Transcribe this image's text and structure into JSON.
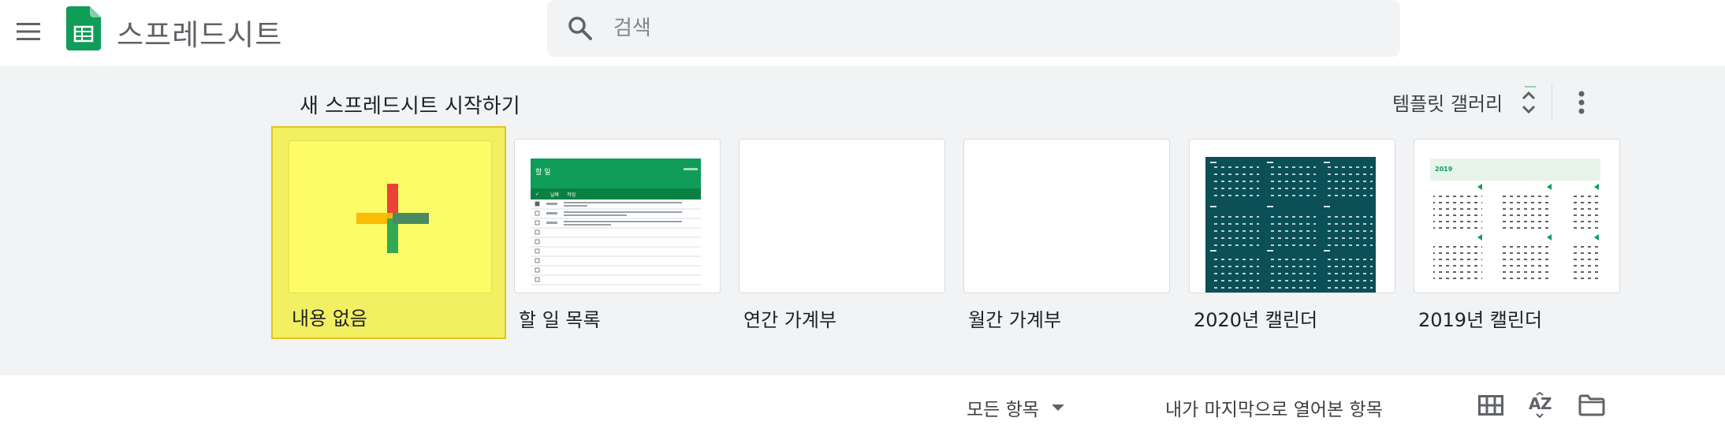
{
  "header": {
    "menu_icon": "hamburger-menu-icon",
    "logo_icon": "google-sheets-logo",
    "app_title": "스프레드시트",
    "search": {
      "placeholder": "검색",
      "value": ""
    }
  },
  "templates": {
    "section_title": "새 스프레드시트 시작하기",
    "gallery_label": "템플릿 갤러리",
    "items": [
      {
        "label": "내용 없음",
        "kind": "blank",
        "highlighted": true
      },
      {
        "label": "할 일 목록",
        "kind": "todo"
      },
      {
        "label": "연간 가계부",
        "kind": "annual-budget"
      },
      {
        "label": "월간 가계부",
        "kind": "monthly-budget"
      },
      {
        "label": "2020년 캘린더",
        "kind": "calendar-2020"
      },
      {
        "label": "2019년 캘린더",
        "kind": "calendar-2019"
      }
    ],
    "thumb_text": {
      "todo_header": "할 일",
      "todo_cols": [
        "✓",
        "날짜",
        "작업"
      ],
      "cal_2019_year": "2019"
    }
  },
  "bottom_bar": {
    "owner_filter": "모든 항목",
    "sort_label": "내가 마지막으로 열어본 항목",
    "icons": [
      "grid-view-icon",
      "sort-az-icon",
      "folder-icon"
    ]
  },
  "colors": {
    "accent_green": "#0f9d58",
    "calendar_teal": "#0b4f57",
    "highlight_yellow": "#f2ef62",
    "plus_red": "#ea4335",
    "plus_yellow": "#fbbc04",
    "plus_green": "#34a853",
    "plus_blue": "#4285f4"
  }
}
